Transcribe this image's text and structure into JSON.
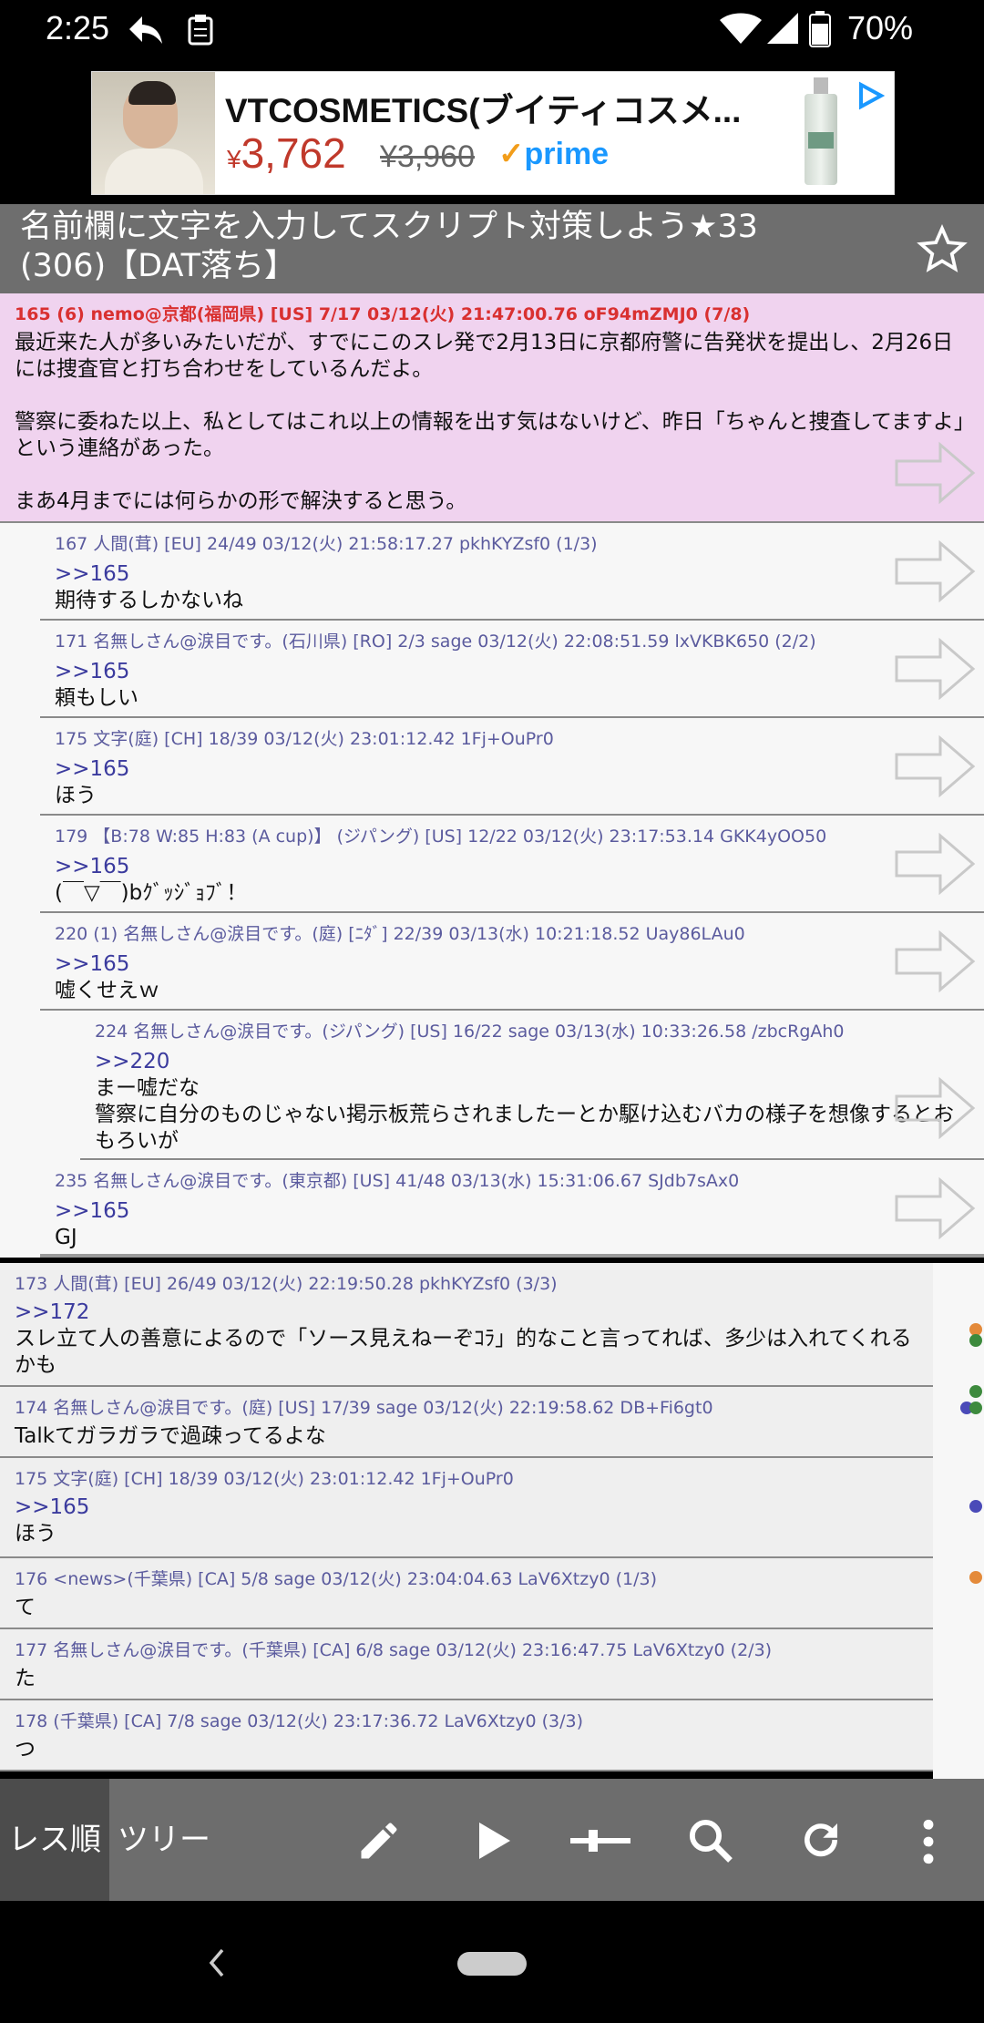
{
  "status": {
    "time": "2:25",
    "battery": "70%"
  },
  "ad": {
    "title": "VTCOSMETICS(ブイティコスメ...",
    "yen": "¥",
    "price": "3,762",
    "old_price": "¥3,960",
    "prime": "prime"
  },
  "thread": {
    "title": "名前欄に文字を入力してスクリプト対策しよう★33 (306)【DAT落ち】"
  },
  "popup": {
    "main": {
      "meta": "165 (6)  nemo@京都(福岡県) [US] 7/17  03/12(火) 21:47:00.76 oF94mZMJ0 (7/8)",
      "lines": [
        "最近来た人が多いみたいだが、すでにこのスレ発で2月13日に京都府警に告発状を提出し、2月26日には捜査官と打ち合わせをしているんだよ。",
        "",
        "警察に委ねた以上、私としてはこれ以上の情報を出す気はないけど、昨日「ちゃんと捜査してますよ」という連絡があった。",
        "",
        "まあ4月までには何らかの形で解決すると思う。"
      ]
    },
    "replies": [
      {
        "meta": "167  人間(茸) [EU] 24/49  03/12(火) 21:58:17.27 pkhKYZsf0 (1/3)",
        "anchor": ">>165",
        "text": "期待するしかないね"
      },
      {
        "meta": "171  名無しさん@涙目です。(石川県) [RO] 2/3 sage 03/12(火) 22:08:51.59 lxVKBK650 (2/2)",
        "anchor": ">>165",
        "text": "頼もしい"
      },
      {
        "meta": "175  文字(庭) [CH] 18/39  03/12(火) 23:01:12.42 1Fj+OuPr0",
        "anchor": ">>165",
        "text": "ほう"
      },
      {
        "meta": "179  【B:78 W:85 H:83 (A cup)】 (ジパング) [US] 12/22  03/12(火) 23:17:53.14 GKK4yOO50",
        "anchor": ">>165",
        "text": "(￣▽￣)bｸﾞｯｼﾞｮﾌﾞ！"
      },
      {
        "meta": "220 (1)  名無しさん@涙目です。(庭) [ﾆﾀﾞ] 22/39  03/13(水) 10:21:18.52 Uay86LAu0",
        "anchor": ">>165",
        "text": "嘘くせえｗ"
      },
      {
        "meta": "224  名無しさん@涙目です。(ジパング) [US] 16/22 sage 03/13(水) 10:33:26.58 /zbcRgAh0",
        "anchor": ">>220",
        "text": "まー嘘だな\n警察に自分のものじゃない掲示板荒らされましたーとか駆け込むバカの様子を想像するとおもろいが"
      },
      {
        "meta": "235  名無しさん@涙目です。(東京都) [US] 41/48  03/13(水) 15:31:06.67 SJdb7sAx0",
        "anchor": ">>165",
        "text": "GJ"
      }
    ]
  },
  "list": [
    {
      "meta": "173  人間(茸) [EU] 26/49  03/12(火) 22:19:50.28 pkhKYZsf0 (3/3)",
      "anchor": ">>172",
      "text": "スレ立て人の善意によるので「ソース見えねーぞｺﾗ」的なこと言ってれば、多少は入れてくれるかも"
    },
    {
      "meta": "174  名無しさん@涙目です。(庭) [US] 17/39 sage 03/12(火) 22:19:58.62 DB+Fi6gt0",
      "anchor": "",
      "text": "Talkてガラガラで過疎ってるよな"
    },
    {
      "meta": "175  文字(庭) [CH] 18/39  03/12(火) 23:01:12.42 1Fj+OuPr0",
      "anchor": ">>165",
      "text": "ほう"
    },
    {
      "meta": "176  <news>(千葉県) [CA] 5/8 sage 03/12(火) 23:04:04.63 LaV6Xtzy0 (1/3)",
      "anchor": "",
      "text": "て"
    },
    {
      "meta": "177  名無しさん@涙目です。(千葉県) [CA] 6/8 sage 03/12(火) 23:16:47.75 LaV6Xtzy0 (2/3)",
      "anchor": "",
      "text": "た"
    },
    {
      "meta": "178  (千葉県) [CA] 7/8 sage 03/12(火) 23:17:36.72 LaV6Xtzy0 (3/3)",
      "anchor": "",
      "text": "つ"
    }
  ],
  "toolbar": {
    "tab_res": "レス順",
    "tab_tree": "ツリー"
  },
  "icons": [
    "back-arrow-icon",
    "clipboard-icon",
    "wifi-icon",
    "signal-icon",
    "battery-icon",
    "star-icon",
    "pencil-icon",
    "play-icon",
    "slider-icon",
    "search-icon",
    "refresh-icon",
    "more-icon"
  ],
  "colors": {
    "popup_main_bg": "#f0d3ef",
    "header_bg": "#6e6e6e",
    "meta_text": "#5b5b9e",
    "id_red": "#d93030"
  }
}
